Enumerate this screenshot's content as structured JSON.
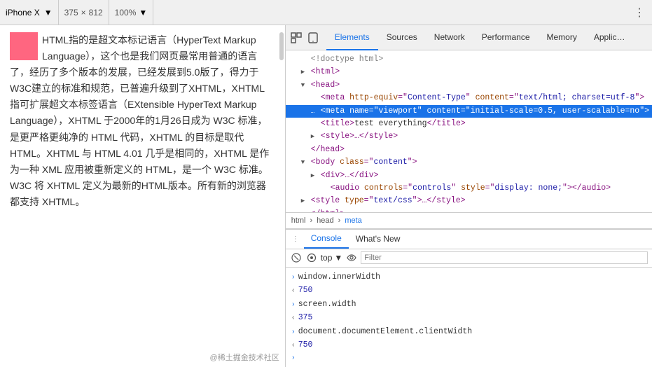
{
  "topbar": {
    "device_name": "iPhone X",
    "dropdown_arrow": "▼",
    "dim_x": "375",
    "dim_cross": "×",
    "dim_y": "812",
    "zoom": "100%",
    "zoom_arrow": "▼",
    "more_icon": "⋮"
  },
  "devtools_tabs": [
    {
      "label": "Elements",
      "active": true
    },
    {
      "label": "Sources",
      "active": false
    },
    {
      "label": "Network",
      "active": false
    },
    {
      "label": "Performance",
      "active": false
    },
    {
      "label": "Memory",
      "active": false
    },
    {
      "label": "Applic…",
      "active": false
    }
  ],
  "devtools_icons": {
    "inspect": "☰",
    "device": "📱"
  },
  "code_lines": [
    {
      "indent": 1,
      "content": "<!doctype html>",
      "arrow": "",
      "type": "comment",
      "highlighted": false
    },
    {
      "indent": 1,
      "content": "<html>",
      "arrow": "▶",
      "type": "tag",
      "highlighted": false
    },
    {
      "indent": 1,
      "content": "<head>",
      "arrow": "▼",
      "type": "tag",
      "highlighted": false
    },
    {
      "indent": 2,
      "content": "<meta http-equiv=\"Content-Type\" content=\"text/html; charset=utf-8\">",
      "arrow": "",
      "type": "tag",
      "highlighted": false
    },
    {
      "indent": 2,
      "content": "<meta name=\"viewport\" content=\"initial-scale=0.5, user-scalable=no\">",
      "arrow": "",
      "type": "tag",
      "highlighted": true
    },
    {
      "indent": 2,
      "content": "<title>test everything</title>",
      "arrow": "",
      "type": "tag",
      "highlighted": false
    },
    {
      "indent": 2,
      "content": "<style>…</style>",
      "arrow": "▶",
      "type": "tag",
      "highlighted": false
    },
    {
      "indent": 1,
      "content": "</head>",
      "arrow": "",
      "type": "tag",
      "highlighted": false
    },
    {
      "indent": 1,
      "content": "<body class=\"content\">",
      "arrow": "▼",
      "type": "tag",
      "highlighted": false
    },
    {
      "indent": 2,
      "content": "<div>…</div>",
      "arrow": "▶",
      "type": "tag",
      "highlighted": false
    },
    {
      "indent": 3,
      "content": "<audio controls=\"controls\" style=\"display: none;\"></audio>",
      "arrow": "",
      "type": "tag",
      "highlighted": false
    },
    {
      "indent": 1,
      "content": "<style type=\"text/css\">…</style>",
      "arrow": "▶",
      "type": "tag",
      "highlighted": false
    },
    {
      "indent": 1,
      "content": "</html>",
      "arrow": "",
      "type": "tag",
      "highlighted": false
    }
  ],
  "breadcrumb": {
    "items": [
      "html",
      "head",
      "meta"
    ]
  },
  "console": {
    "tabs": [
      {
        "label": "Console",
        "active": true
      },
      {
        "label": "What's New",
        "active": false
      }
    ],
    "top_label": "top",
    "filter_placeholder": "Filter",
    "rows": [
      {
        "dir": "out",
        "label": "window.innerWidth",
        "value": ""
      },
      {
        "dir": "in",
        "label": "750",
        "value": "750",
        "is_value": true
      },
      {
        "dir": "out",
        "label": "screen.width",
        "value": ""
      },
      {
        "dir": "in",
        "label": "375",
        "value": "375",
        "is_value": true
      },
      {
        "dir": "out",
        "label": "document.documentElement.clientWidth",
        "value": ""
      },
      {
        "dir": "in",
        "label": "750",
        "value": "750",
        "is_value": true
      },
      {
        "dir": "out",
        "label": "",
        "value": ""
      }
    ]
  },
  "phone_content": {
    "text": "HTML指的是超文本标记语言（HyperText Markup Language），这个也是我们网页最常用普通的语言了，经历了多个版本的发展，已经发展到5.0版了，得力于W3C建立的标准和规范，已普遍升级到了XHTML，XHTML 指可扩展超文本标签语言（EXtensible HyperText Markup Language），XHTML 于2000年的1月26日成为 W3C 标准，是更严格更纯净的 HTML 代码，XHTML 的目标是取代 HTML。XHTML 与 HTML 4.01 几乎是相同的，XHTML 是作为一种 XML 应用被重新定义的 HTML，是一个 W3C 标准。W3C 将 XHTML 定义为最新的HTML版本。所有新的浏览器都支持 XHTML。"
  },
  "watermark": "@稀土掘金技术社区"
}
